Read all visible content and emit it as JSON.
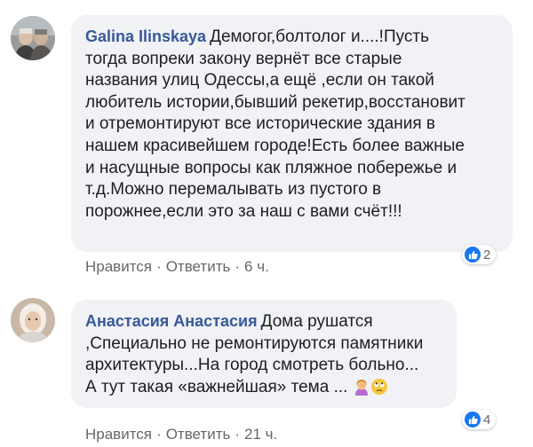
{
  "comments": [
    {
      "author": "Galina Ilinskaya",
      "text": "Демогог,болтолог и....!Пусть\nтогда вопреки закону вернёт все старые\nназвания улиц Одессы,а ещё ,если он такой\nлюбитель истории,бывший рекетир,восстановит\nи отремонтируют все исторические здания в\nнашем красивейшем городе!Есть более важные\nи насущные вопросы как пляжное побережье и\nт.д.Можно перемалывать из пустого в\nпорожнее,если это за наш с вами счёт!!!",
      "reaction_count": "2",
      "like_label": "Нравится",
      "reply_label": "Ответить",
      "time": "6 ч."
    },
    {
      "author": "Анастасия Анастасия",
      "text_first": "Дома рушатся\n,Специально не ремонтируются памятники\nархитектуры...На город смотреть больно...\nА тут такая «важнейшая» тема ...",
      "emojis": [
        "woman-facepalming-emoji",
        "rolling-eyes-emoji"
      ],
      "reaction_count": "4",
      "like_label": "Нравится",
      "reply_label": "Ответить",
      "time": "21 ч."
    }
  ],
  "separator": "·",
  "colors": {
    "author": "#385898",
    "bubble": "#f0f2f5",
    "meta": "#65676b",
    "like": "#1877f2"
  }
}
